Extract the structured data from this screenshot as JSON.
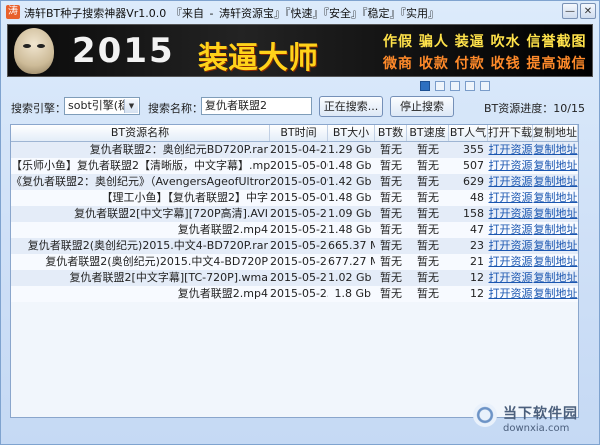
{
  "window": {
    "title": "涛轩BT种子搜索神器Vr1.0.0",
    "menu_text": "『来自 - 涛轩资源宝』『快速』『安全』『稳定』『实用』",
    "icon_glyph": "涛",
    "min_glyph": "—",
    "close_glyph": "✕"
  },
  "banner": {
    "year": "2015",
    "headline": "装逼大师",
    "line1": "作假 骗人 装逼 吹水 信誉截图",
    "line2": "微商 收款 付款 收钱 提高诚信"
  },
  "search": {
    "engine_label": "搜索引擎：",
    "engine_value": "sobt引擎(稳)",
    "name_label": "搜索名称：",
    "name_value": "复仇者联盟2",
    "searching_button": "正在搜索...",
    "stop_button": "停止搜索",
    "progress_text": "BT资源进度：10/15"
  },
  "table": {
    "headers": [
      "BT资源名称",
      "BT时间",
      "BT大小",
      "BT数",
      "BT速度",
      "BT人气",
      "打开下载",
      "复制地址"
    ],
    "rows": [
      [
        "复仇者联盟2：奥创纪元BD720P.rar",
        "2015-04-25",
        "1.29 Gb",
        "暂无",
        "暂无",
        "355",
        "打开资源",
        "复制地址"
      ],
      [
        "【乐师小鱼】复仇者联盟2【清晰版，中文字幕】.mp4",
        "2015-05-06",
        "1.48 Gb",
        "暂无",
        "暂无",
        "507",
        "打开资源",
        "复制地址"
      ],
      [
        "《复仇者联盟2：奥创纪元》（AvengersAgeofUltron）复",
        "2015-05-09",
        "1.42 Gb",
        "暂无",
        "暂无",
        "629",
        "打开资源",
        "复制地址"
      ],
      [
        "【理工小鱼】【复仇者联盟2】中字",
        "2015-05-06",
        "1.48 Gb",
        "暂无",
        "暂无",
        "48",
        "打开资源",
        "复制地址"
      ],
      [
        "复仇者联盟2[中文字幕][720P高清].AVI",
        "2015-05-21",
        "1.09 Gb",
        "暂无",
        "暂无",
        "158",
        "打开资源",
        "复制地址"
      ],
      [
        "复仇者联盟2.mp4",
        "2015-05-25",
        "1.48 Gb",
        "暂无",
        "暂无",
        "47",
        "打开资源",
        "复制地址"
      ],
      [
        "复仇者联盟2(奥创纪元)2015.中文4-BD720P.rar",
        "2015-05-25",
        "665.37 M",
        "暂无",
        "暂无",
        "23",
        "打开资源",
        "复制地址"
      ],
      [
        "复仇者联盟2(奥创纪元)2015.中文4-BD720P",
        "2015-05-25",
        "677.27 M",
        "暂无",
        "暂无",
        "21",
        "打开资源",
        "复制地址"
      ],
      [
        "复仇者联盟2[中文字幕][TC-720P].wma",
        "2015-05-21",
        "1.02 Gb",
        "暂无",
        "暂无",
        "12",
        "打开资源",
        "复制地址"
      ],
      [
        "复仇者联盟2.mp4",
        "2015-05-25",
        "1.8 Gb",
        "暂无",
        "暂无",
        "12",
        "打开资源",
        "复制地址"
      ]
    ]
  },
  "watermark": {
    "big": "涛轩",
    "small": "BT",
    "site_name": "当下软件园",
    "site_url": "downxia.com"
  },
  "colors": {
    "accent": "#2d6fc0",
    "link": "#1a56b0",
    "banner_gold": "#ffd21a"
  },
  "pager": {
    "count": 5,
    "active_index": 0
  }
}
